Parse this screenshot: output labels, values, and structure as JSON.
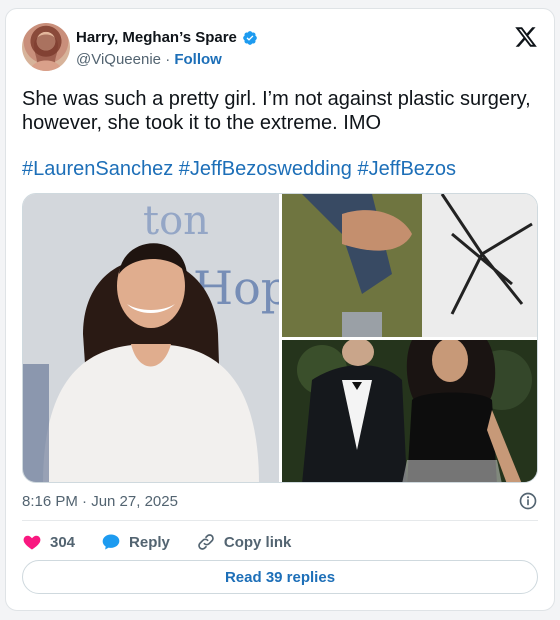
{
  "author": {
    "display_name": "Harry, Meghan’s Spare",
    "handle": "@ViQueenie",
    "separator": "·",
    "follow_label": "Follow",
    "verified_color": "#1d9bf0"
  },
  "tweet": {
    "text": "She was such a pretty girl. I’m not against plastic surgery, however, she took it to the extreme. IMO",
    "hashtags": [
      "#LaurenSanchez",
      "#JeffBezoswedding",
      "#JeffBezos"
    ],
    "timestamp": "8:16 PM · Jun 27, 2025"
  },
  "actions": {
    "like_count": "304",
    "reply_label": "Reply",
    "copy_link_label": "Copy link",
    "read_replies_label": "Read 39 replies"
  },
  "icons": {
    "x_logo": "x-logo-icon",
    "verified": "verified-badge-icon",
    "info": "info-icon",
    "like": "heart-icon",
    "reply": "reply-bubble-icon",
    "copy": "link-icon"
  },
  "colors": {
    "link_blue": "#1d6fb8",
    "heart_pink": "#f91880",
    "muted": "#536471"
  }
}
